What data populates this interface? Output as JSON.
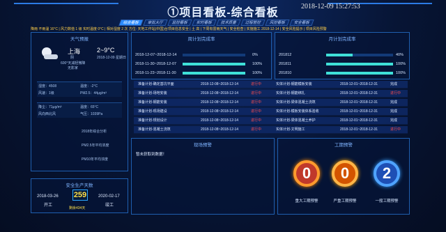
{
  "header": {
    "title": "①项目看板-综合看板",
    "datetime": "2018-12-09 15:27:53"
  },
  "tabs": [
    "综合看板",
    "审批大厅",
    "监控看板",
    "实时看板",
    "技术质量",
    "过程管控",
    "风控看板",
    "安全看板"
  ],
  "ticker": "降雨 不雨温 16°C | 风力数值 1 级  实时温度 0°C | 相对湿度 2 次 方位: 天地工作站(中国)台项目信息安全 | 土 高 | 下周有雷雨天气 | 安全检查 | 实施施工 2018-12-14 | 安全风险提示 | 项目风险预警",
  "weather": {
    "title": "天气预报",
    "city": "上海",
    "temp": "2~9°C",
    "condition": "阴",
    "date": "2018-12-09 星期日",
    "aqi": "600°天减轻微降",
    "wind": "无影家",
    "humidity_label": "湿度：4508",
    "temp_label": "温度：-2°C",
    "wind_label": "风速：1级",
    "pm_label": "PM2.5：44μg/m³",
    "r2a": "降尘：71μg/m³",
    "r2b": "温度：65°C",
    "r2c": "风向西北风",
    "r2d": "气压：1039Pa",
    "s1": "2018年综合分析",
    "s2": "PM2.5年平均浓度",
    "s3": "PM10年平均浓度"
  },
  "safety": {
    "title": "安全生产天数",
    "start_date": "2018-03-26",
    "start_label": "开工",
    "end_date": "2020-02-17",
    "end_label": "竣工",
    "days": "259",
    "remaining": "剩余434天"
  },
  "weekly": {
    "title": "周计划完成率",
    "rows": [
      {
        "range": "2018-12-07~2018-12-14",
        "pct": "0%",
        "v": 0
      },
      {
        "range": "2018-11-30~2018-12-07",
        "pct": "100%",
        "v": 100
      },
      {
        "range": "2018-11-23~2018-11-30",
        "pct": "100%",
        "v": 100
      }
    ]
  },
  "monthly": {
    "title": "月计划完成率",
    "rows": [
      {
        "month": "201812",
        "pct": "40%",
        "v": 40
      },
      {
        "month": "201811",
        "pct": "100%",
        "v": 100
      },
      {
        "month": "201810",
        "pct": "100%",
        "v": 100
      }
    ]
  },
  "tasks": [
    {
      "a": "准备计划-确定基坑平面",
      "b": "2018-12-08~2018-12-14",
      "c": "进行中",
      "d": "实体计划-钢筋模板安装",
      "e": "2018-12-01~2018-12-31",
      "f": "完成"
    },
    {
      "a": "准备计划-场地安装",
      "b": "2018-12-08~2018-12-14",
      "c": "进行中",
      "d": "实体计划-钢筋绑扎",
      "e": "2018-12-01~2018-12-31",
      "f": "进行中"
    },
    {
      "a": "准备计划-钢筋安装",
      "b": "2018-12-08~2018-12-14",
      "c": "进行中",
      "d": "实体计划-梁体混凝土浇筑",
      "e": "2018-12-01~2018-12-31",
      "f": "完成"
    },
    {
      "a": "准备计划-现场建设",
      "b": "2018-12-08~2018-12-14",
      "c": "进行中",
      "d": "实体计划-模板安装体系验收",
      "e": "2018-12-01~2018-12-31",
      "f": "完成"
    },
    {
      "a": "准备计划-规划设计",
      "b": "2018-12-08~2018-12-14",
      "c": "进行中",
      "d": "实体计划-梁体混凝土养护",
      "e": "2018-12-01~2018-12-31",
      "f": "完成"
    },
    {
      "a": "准备计划-混凝土浇筑",
      "b": "2018-12-08~2018-12-14",
      "c": "进行中",
      "d": "实体计划-文明施工",
      "e": "2018-12-01~2018-12-31",
      "f": "进行中"
    }
  ],
  "site": {
    "title": "现场预警",
    "message": "暂未获取到数据！"
  },
  "period": {
    "title": "工期预警",
    "items": [
      {
        "value": "0",
        "label": "重大工期预警",
        "color": "red"
      },
      {
        "value": "0",
        "label": "严重工期预警",
        "color": "orange"
      },
      {
        "value": "2",
        "label": "一般工期预警",
        "color": "blue"
      }
    ]
  },
  "colors": {
    "accent": "#2a8bff",
    "bar": "#3fe0d8",
    "alert": "#ff4d4d"
  }
}
